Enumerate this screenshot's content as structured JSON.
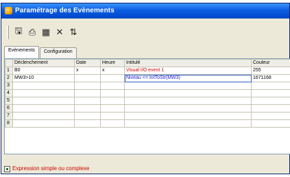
{
  "window": {
    "title": "Paramétrage des Evènements"
  },
  "toolbar": {
    "icons": [
      "save-icon",
      "print-icon",
      "grid-icon",
      "delete-icon",
      "sort-icon"
    ],
    "glyphs": {
      "save": "🖫",
      "print": "⎙",
      "grid": "▦",
      "delete": "✕",
      "sort": "⇅"
    }
  },
  "tabs": [
    {
      "label": "Evènements",
      "active": true
    },
    {
      "label": "Configuration",
      "active": false
    }
  ],
  "grid": {
    "columns": [
      "",
      "Déclenchement",
      "Date",
      "Heure",
      "Intitulé",
      "Couleur"
    ],
    "rows": [
      {
        "num": "1",
        "trigger": "B0",
        "date": "x",
        "time": "x",
        "label": "Visual I/O event 1",
        "color": "255"
      },
      {
        "num": "2",
        "trigger": "MW3>10",
        "date": "",
        "time": "",
        "label": "Niveau <= IntToStr(MW3)",
        "color": "1671168"
      },
      {
        "num": "3",
        "trigger": "",
        "date": "",
        "time": "",
        "label": "",
        "color": ""
      },
      {
        "num": "4",
        "trigger": "",
        "date": "",
        "time": "",
        "label": "",
        "color": ""
      },
      {
        "num": "5",
        "trigger": "",
        "date": "",
        "time": "",
        "label": "",
        "color": ""
      },
      {
        "num": "6",
        "trigger": "",
        "date": "",
        "time": "",
        "label": "",
        "color": ""
      },
      {
        "num": "7",
        "trigger": "",
        "date": "",
        "time": "",
        "label": "",
        "color": ""
      },
      {
        "num": "8",
        "trigger": "",
        "date": "",
        "time": "",
        "label": "",
        "color": ""
      }
    ]
  },
  "status": {
    "text": "Expression simple ou complexe",
    "color": "#d00000"
  },
  "colors": {
    "titlebar": "#0a5ce0",
    "window_bg": "#ece9d8",
    "label_red": "#d00000",
    "label_blue": "#1a1ad0"
  }
}
